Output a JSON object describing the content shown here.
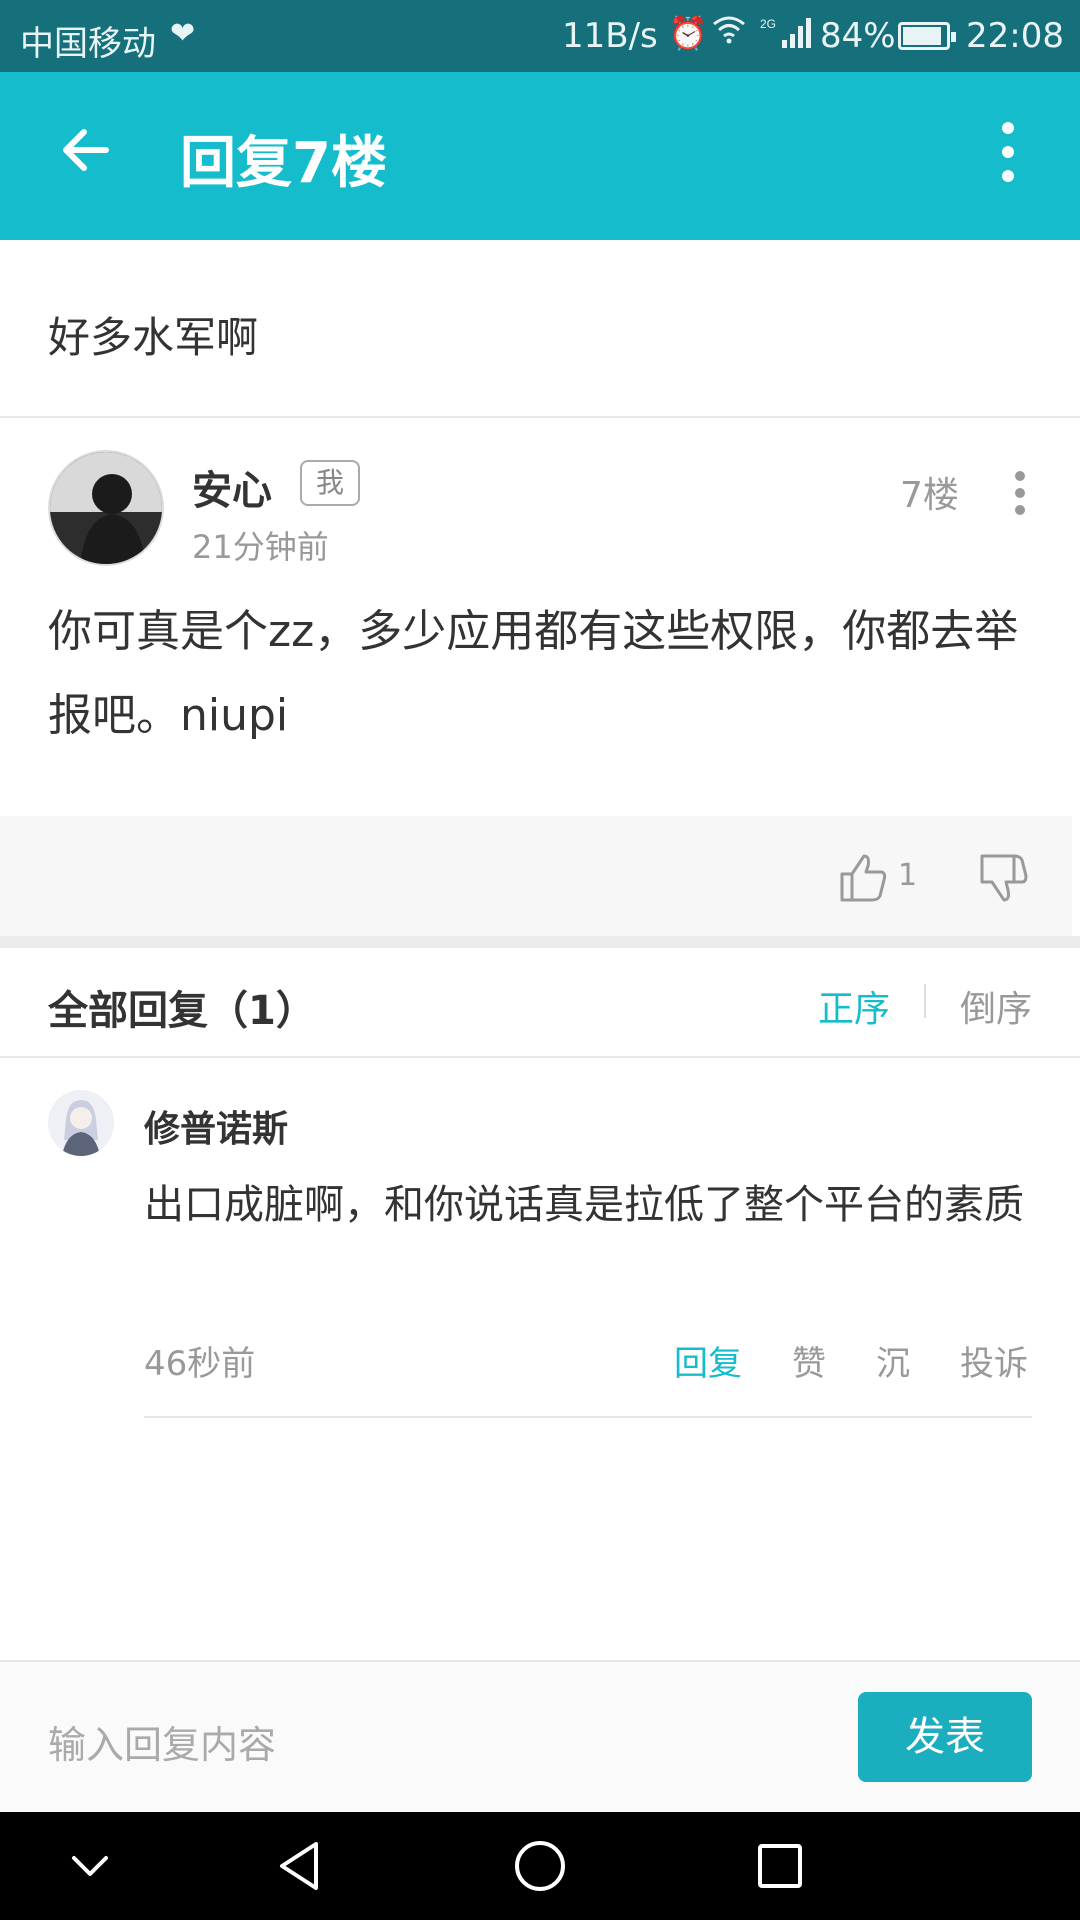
{
  "status_bar": {
    "carrier": "中国移动",
    "network_speed": "11B/s",
    "signal_label": "2G",
    "battery": "84%",
    "time": "22:08"
  },
  "app_bar": {
    "title": "回复7楼"
  },
  "post": {
    "title": "好多水军啊"
  },
  "reply": {
    "author": "安心",
    "me_tag": "我",
    "time": "21分钟前",
    "floor": "7楼",
    "content": "你可真是个zz，多少应用都有这些权限，你都去举报吧。niupi",
    "like_count": "1"
  },
  "all_replies": {
    "heading": "全部回复（1）",
    "sort_asc": "正序",
    "sort_desc": "倒序"
  },
  "sub_reply": {
    "author": "修普诺斯",
    "content": "出口成脏啊，和你说话真是拉低了整个平台的素质",
    "time": "46秒前",
    "actions": {
      "reply": "回复",
      "like": "赞",
      "sink": "沉",
      "report": "投诉"
    }
  },
  "composer": {
    "placeholder": "输入回复内容",
    "send_label": "发表"
  },
  "colors": {
    "accent": "#14bccc",
    "status_bar": "#16707c",
    "send_button": "#1aaebf"
  },
  "icons": [
    "heart-pulse-icon",
    "alarm-icon",
    "wifi-icon",
    "signal-icon",
    "battery-icon",
    "back-arrow-icon",
    "more-vert-icon",
    "thumbs-up-icon",
    "thumbs-down-icon",
    "nav-collapse-icon",
    "nav-back-icon",
    "nav-home-icon",
    "nav-recents-icon"
  ]
}
